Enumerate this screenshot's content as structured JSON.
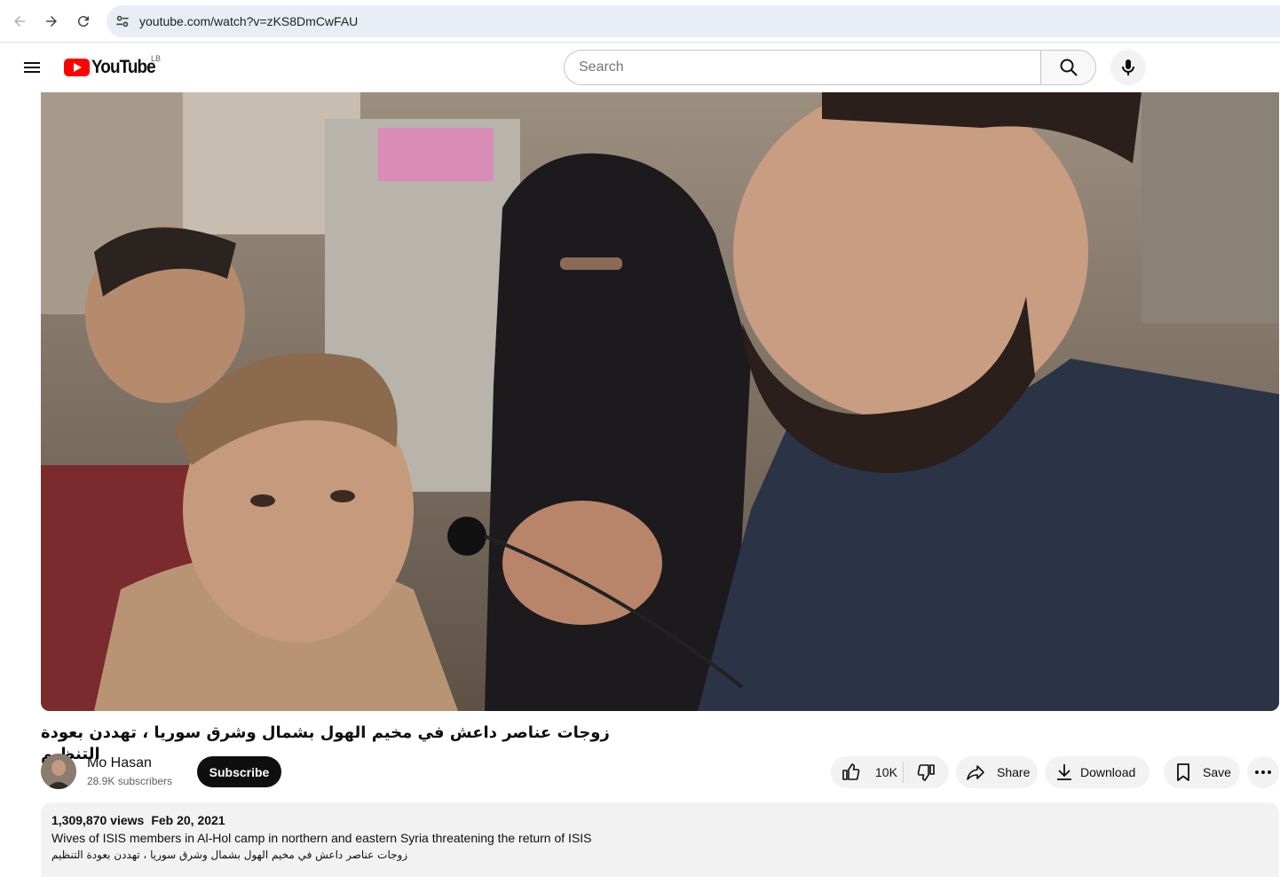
{
  "browser": {
    "url": "youtube.com/watch?v=zKS8DmCwFAU"
  },
  "header": {
    "logo_text": "YouTube",
    "region": "LB",
    "search_placeholder": "Search"
  },
  "video": {
    "title": "زوجات عناصر داعش في مخيم الهول بشمال وشرق سوريا ، تهددن بعودة التنظيم"
  },
  "channel": {
    "name": "Mo Hasan",
    "subscribers": "28.9K subscribers",
    "subscribe_label": "Subscribe"
  },
  "actions": {
    "likes": "10K",
    "share": "Share",
    "download": "Download",
    "save": "Save"
  },
  "description": {
    "views": "1,309,870 views",
    "date": "Feb 20, 2021",
    "line1": "Wives of ISIS members in Al-Hol camp in northern and eastern Syria threatening the return of ISIS",
    "line2": "زوجات عناصر داعش في مخيم الهول بشمال وشرق سوريا ، تهددن بعودة التنظيم"
  }
}
